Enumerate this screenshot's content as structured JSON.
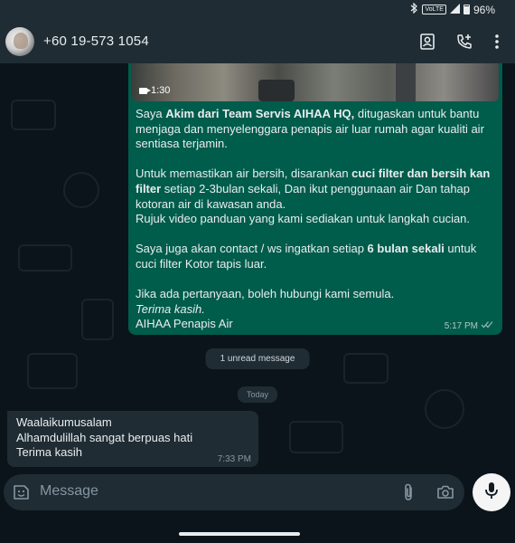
{
  "status_bar": {
    "battery": "96%",
    "icons": [
      "bluetooth-icon",
      "volte-icon",
      "signal-icon",
      "battery-icon"
    ],
    "volte_label": "VoLTE"
  },
  "header": {
    "contact": "+60 19-573 1054",
    "icons": [
      "contact-card-icon",
      "add-call-icon",
      "more-options-icon"
    ]
  },
  "messages": {
    "outgoing": {
      "video_duration": "1:30",
      "paragraphs": [
        {
          "parts": [
            {
              "t": "Saya ",
              "b": false
            },
            {
              "t": "Akim dari Team Servis AIHAA HQ,",
              "b": true
            },
            {
              "t": " ditugaskan untuk bantu menjaga dan menyelenggara penapis air luar rumah agar kualiti air sentiasa terjamin.",
              "b": false
            }
          ]
        },
        {
          "parts": [
            {
              "t": "Untuk memastikan air bersih, disarankan ",
              "b": false
            },
            {
              "t": "cuci filter dan bersih kan filter",
              "b": true
            },
            {
              "t": " setiap 2-3bulan sekali, Dan ikut penggunaan air Dan tahap kotoran air di kawasan anda.\nRujuk video panduan yang kami sediakan untuk langkah cucian.",
              "b": false
            }
          ]
        },
        {
          "parts": [
            {
              "t": "Saya juga akan contact / ws ingatkan setiap ",
              "b": false
            },
            {
              "t": "6 bulan sekali",
              "b": true
            },
            {
              "t": " untuk cuci filter Kotor tapis luar.",
              "b": false
            }
          ]
        },
        {
          "parts": [
            {
              "t": "Jika ada pertanyaan, boleh hubungi kami semula.\n",
              "b": false
            },
            {
              "t": "Terima kasih.",
              "b": false,
              "i": true
            },
            {
              "t": "\nAIHAA Penapis Air",
              "b": false
            }
          ]
        }
      ],
      "time": "5:17 PM"
    },
    "unread_label": "1 unread message",
    "date_label": "Today",
    "incoming": {
      "text": "Waalaikumusalam\nAlhamdulillah sangat berpuas hati\nTerima kasih",
      "time": "7:33 PM"
    }
  },
  "composer": {
    "placeholder": "Message",
    "icons": [
      "emoji-icon",
      "attach-icon",
      "camera-icon",
      "mic-icon"
    ]
  },
  "colors": {
    "background": "#0b141a",
    "header": "#1f2c34",
    "outgoing_bubble": "#005c4b",
    "incoming_bubble": "#1f2c34",
    "read_ticks": "#8eb4ac"
  }
}
